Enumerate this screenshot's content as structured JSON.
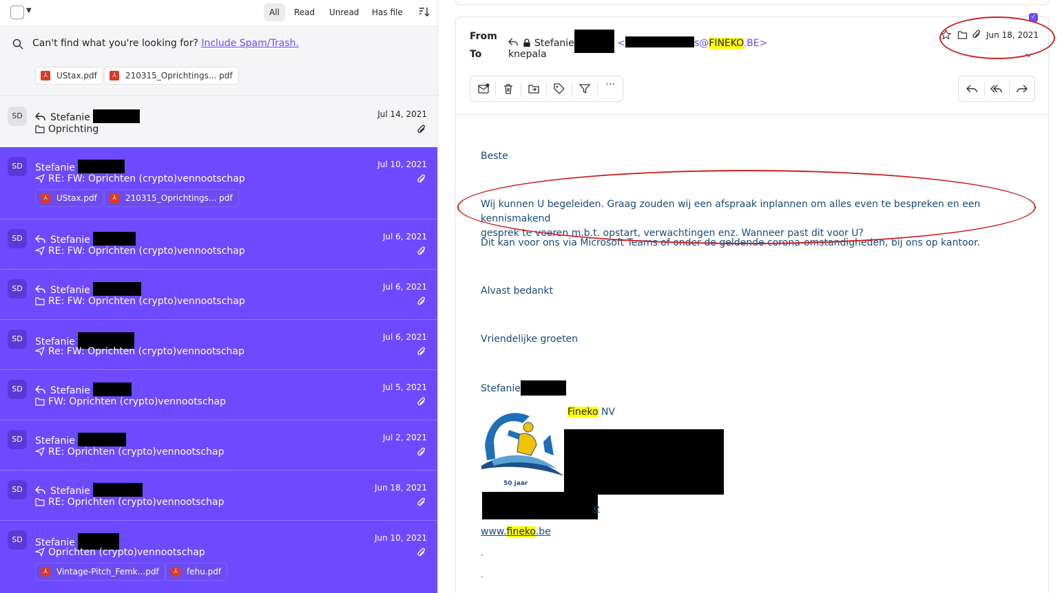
{
  "filters": {
    "all": "All",
    "read": "Read",
    "unread": "Unread",
    "has_file": "Has file"
  },
  "spam": {
    "prefix": "Can't find what you're looking for?",
    "link": "Include Spam/Trash."
  },
  "top_chips": [
    "UStax.pdf",
    "210315_Oprichtings... pdf"
  ],
  "rows": [
    {
      "avatar": "SD",
      "sender": "Stefanie",
      "date": "Jul 14, 2021",
      "subject": "Oprichting"
    },
    {
      "avatar": "SD",
      "sender": "Stefanie",
      "date": "Jul 10, 2021",
      "subject": "RE: FW: Oprichten (crypto)vennootschap",
      "chips": [
        "UStax.pdf",
        "210315_Oprichtings... pdf"
      ]
    },
    {
      "avatar": "SD",
      "sender": "Stefanie",
      "date": "Jul 6, 2021",
      "subject": "RE: FW: Oprichten (crypto)vennootschap"
    },
    {
      "avatar": "SD",
      "sender": "Stefanie",
      "date": "Jul 6, 2021",
      "subject": "RE: FW: Oprichten (crypto)vennootschap"
    },
    {
      "avatar": "SD",
      "sender": "Stefanie",
      "date": "Jul 6, 2021",
      "subject": "Re: FW: Oprichten (crypto)vennootschap"
    },
    {
      "avatar": "SD",
      "sender": "Stefanie",
      "date": "Jul 5, 2021",
      "subject": "FW: Oprichten (crypto)vennootschap"
    },
    {
      "avatar": "SD",
      "sender": "Stefanie",
      "date": "Jul 2, 2021",
      "subject": "RE: Oprichten (crypto)vennootschap"
    },
    {
      "avatar": "SD",
      "sender": "Stefanie",
      "date": "Jun 18, 2021",
      "subject": "RE: Oprichten (crypto)vennootschap"
    },
    {
      "avatar": "SD",
      "sender": "Stefanie",
      "date": "Jun 10, 2021",
      "subject": "Oprichten (crypto)vennootschap",
      "chips": [
        "Vintage-Pitch_Femk...pdf",
        "fehu.pdf"
      ]
    }
  ],
  "message": {
    "from_label": "From",
    "to_label": "To",
    "from_name": "Stefanie",
    "from_addr_prefix": "<",
    "from_addr_s": "s@",
    "from_addr_domain": "FINEKO",
    "from_addr_suffix": ".BE>",
    "to_name": "knepala",
    "date": "Jun 18, 2021",
    "body": {
      "greeting": "Beste",
      "p1": "Wij kunnen U begeleiden. Graag zouden wij een afspraak inplannen om alles even te bespreken en een kennismakend\ngesprek te voeren m.b.t. opstart, verwachtingen enz. Wanneer past dit voor U?",
      "p2": "Dit kan voor ons via Microsoft Teams of onder de geldende corona-omstandigheden, bij ons op kantoor.",
      "p3": "Alvast bedankt",
      "p4": "Vriendelijke groeten",
      "sig_name": "Stefanie",
      "company_hl": "Fineko",
      "company_rest": " NV",
      "logo_text": "50 jaar",
      "web_prefix": "www.",
      "web_hl": "fineko",
      "web_suffix": ".be",
      "trail_link": "e",
      "dot1": "-",
      "dot2": "-"
    }
  }
}
